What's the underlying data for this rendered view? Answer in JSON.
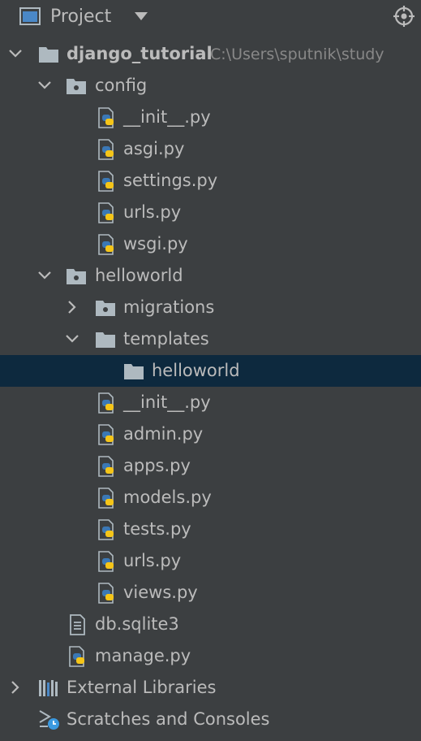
{
  "header": {
    "title": "Project"
  },
  "tree": {
    "root": {
      "label": "django_tutorial",
      "path": "C:\\Users\\sputnik\\study"
    },
    "config": {
      "label": "config",
      "files": [
        "__init__.py",
        "asgi.py",
        "settings.py",
        "urls.py",
        "wsgi.py"
      ]
    },
    "helloworld": {
      "label": "helloworld",
      "migrations": "migrations",
      "templates": "templates",
      "templates_child": "helloworld",
      "files": [
        "__init__.py",
        "admin.py",
        "apps.py",
        "models.py",
        "tests.py",
        "urls.py",
        "views.py"
      ]
    },
    "db": "db.sqlite3",
    "manage": "manage.py",
    "external_libraries": "External Libraries",
    "scratches": "Scratches and Consoles"
  },
  "colors": {
    "background": "#3c3f41",
    "selection": "#0d293e",
    "text": "#bbbbbb",
    "path_text": "#888888",
    "folder": "#aeb9c0",
    "python_blue": "#3b78b5",
    "python_yellow": "#f5c518"
  }
}
